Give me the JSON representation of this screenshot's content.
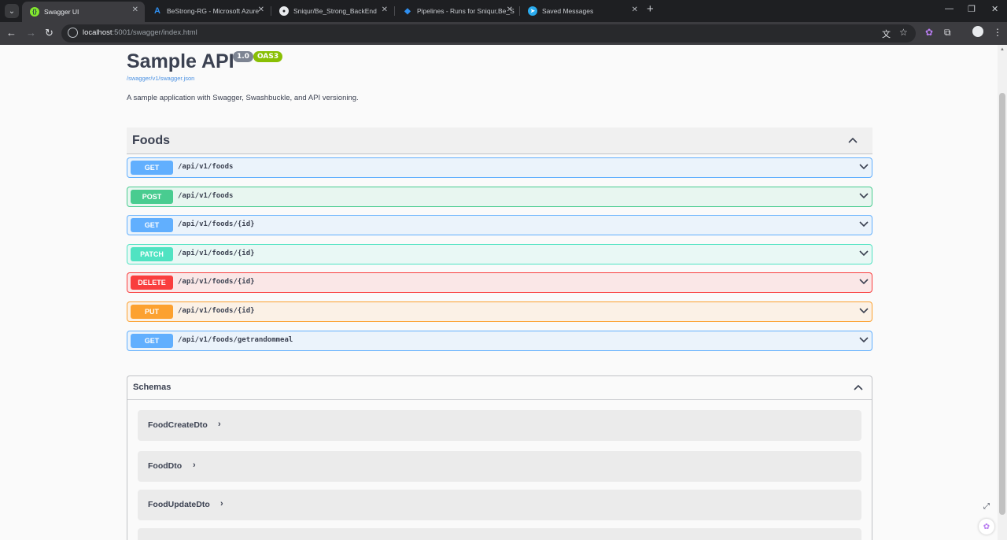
{
  "browser": {
    "tabs": [
      {
        "title": "Swagger UI",
        "active": true,
        "icon": "swagger-icon"
      },
      {
        "title": "BeStrong-RG - Microsoft Azure",
        "active": false,
        "icon": "azure-icon"
      },
      {
        "title": "Sniqur/Be_Strong_BackEnd",
        "active": false,
        "icon": "github-icon"
      },
      {
        "title": "Pipelines - Runs for Sniqur,Be_S",
        "active": false,
        "icon": "azure-devops-icon"
      },
      {
        "title": "Saved Messages",
        "active": false,
        "icon": "telegram-icon"
      }
    ],
    "address": {
      "host": "localhost",
      "path": ":5001/swagger/index.html"
    }
  },
  "api": {
    "title": "Sample API",
    "version": "1.0",
    "oas": "OAS3",
    "spec_link": "/swagger/v1/swagger.json",
    "description": "A sample application with Swagger, Swashbuckle, and API versioning."
  },
  "tag_section": {
    "name": "Foods",
    "expanded": true
  },
  "operations": [
    {
      "method": "GET",
      "path": "/api/v1/foods"
    },
    {
      "method": "POST",
      "path": "/api/v1/foods"
    },
    {
      "method": "GET",
      "path": "/api/v1/foods/{id}"
    },
    {
      "method": "PATCH",
      "path": "/api/v1/foods/{id}"
    },
    {
      "method": "DELETE",
      "path": "/api/v1/foods/{id}"
    },
    {
      "method": "PUT",
      "path": "/api/v1/foods/{id}"
    },
    {
      "method": "GET",
      "path": "/api/v1/foods/getrandommeal"
    }
  ],
  "schemas": {
    "title": "Schemas",
    "models": [
      "FoodCreateDto",
      "FoodDto",
      "FoodUpdateDto"
    ]
  },
  "colors": {
    "get": "#61affe",
    "post": "#49cc90",
    "patch": "#50e3c2",
    "delete": "#f93e3e",
    "put": "#fca130",
    "text": "#3b4151"
  }
}
